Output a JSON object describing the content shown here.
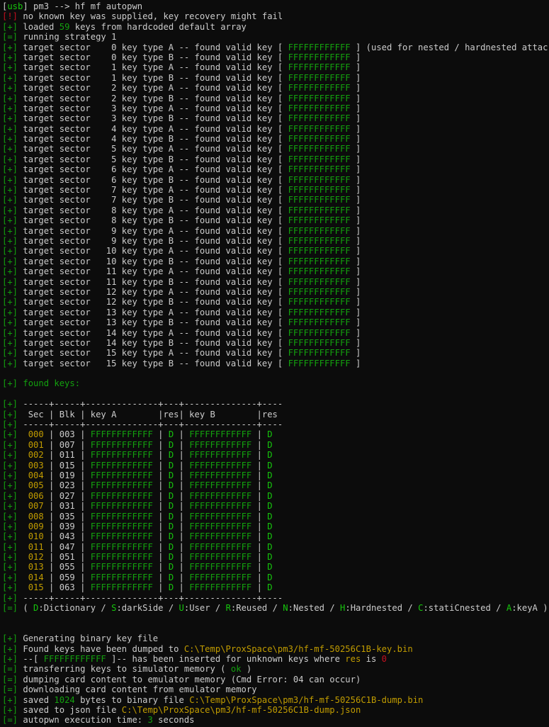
{
  "window": {
    "prompt_prefix": "usb",
    "prompt_host": "pm3",
    "command": "hf mf autopwn"
  },
  "colors": {
    "background": "#0c0c0c",
    "text": "#cccccc",
    "green": "#13a10e",
    "bright_green": "#16c60c",
    "yellow": "#c19c00",
    "red": "#c50f1f"
  },
  "intro": [
    {
      "tag": "!",
      "text": "no known key was supplied, key recovery might fail"
    },
    {
      "tag": "+",
      "pre": "loaded ",
      "num": "59",
      "post": " keys from hardcoded default array"
    },
    {
      "tag": "=",
      "text": "running strategy 1"
    }
  ],
  "sector_key": "FFFFFFFFFFFF",
  "first_note": "(used for nested / hardnested attack)",
  "sector_lines": [
    {
      "sec": "0",
      "type": "A"
    },
    {
      "sec": "0",
      "type": "B"
    },
    {
      "sec": "1",
      "type": "A"
    },
    {
      "sec": "1",
      "type": "B"
    },
    {
      "sec": "2",
      "type": "A"
    },
    {
      "sec": "2",
      "type": "B"
    },
    {
      "sec": "3",
      "type": "A"
    },
    {
      "sec": "3",
      "type": "B"
    },
    {
      "sec": "4",
      "type": "A"
    },
    {
      "sec": "4",
      "type": "B"
    },
    {
      "sec": "5",
      "type": "A"
    },
    {
      "sec": "5",
      "type": "B"
    },
    {
      "sec": "6",
      "type": "A"
    },
    {
      "sec": "6",
      "type": "B"
    },
    {
      "sec": "7",
      "type": "A"
    },
    {
      "sec": "7",
      "type": "B"
    },
    {
      "sec": "8",
      "type": "A"
    },
    {
      "sec": "8",
      "type": "B"
    },
    {
      "sec": "9",
      "type": "A"
    },
    {
      "sec": "9",
      "type": "B"
    },
    {
      "sec": "10",
      "type": "A"
    },
    {
      "sec": "10",
      "type": "B"
    },
    {
      "sec": "11",
      "type": "A"
    },
    {
      "sec": "11",
      "type": "B"
    },
    {
      "sec": "12",
      "type": "A"
    },
    {
      "sec": "12",
      "type": "B"
    },
    {
      "sec": "13",
      "type": "A"
    },
    {
      "sec": "13",
      "type": "B"
    },
    {
      "sec": "14",
      "type": "A"
    },
    {
      "sec": "14",
      "type": "B"
    },
    {
      "sec": "15",
      "type": "A"
    },
    {
      "sec": "15",
      "type": "B"
    }
  ],
  "found_keys_label": "found keys:",
  "table": {
    "separator": "-----+-----+--------------+---+--------------+----",
    "headers": [
      "Sec",
      "Blk",
      "key A",
      "res",
      "key B",
      "res"
    ],
    "rows": [
      {
        "sec": "000",
        "blk": "003",
        "keyA": "FFFFFFFFFFFF",
        "resA": "D",
        "keyB": "FFFFFFFFFFFF",
        "resB": "D"
      },
      {
        "sec": "001",
        "blk": "007",
        "keyA": "FFFFFFFFFFFF",
        "resA": "D",
        "keyB": "FFFFFFFFFFFF",
        "resB": "D"
      },
      {
        "sec": "002",
        "blk": "011",
        "keyA": "FFFFFFFFFFFF",
        "resA": "D",
        "keyB": "FFFFFFFFFFFF",
        "resB": "D"
      },
      {
        "sec": "003",
        "blk": "015",
        "keyA": "FFFFFFFFFFFF",
        "resA": "D",
        "keyB": "FFFFFFFFFFFF",
        "resB": "D"
      },
      {
        "sec": "004",
        "blk": "019",
        "keyA": "FFFFFFFFFFFF",
        "resA": "D",
        "keyB": "FFFFFFFFFFFF",
        "resB": "D"
      },
      {
        "sec": "005",
        "blk": "023",
        "keyA": "FFFFFFFFFFFF",
        "resA": "D",
        "keyB": "FFFFFFFFFFFF",
        "resB": "D"
      },
      {
        "sec": "006",
        "blk": "027",
        "keyA": "FFFFFFFFFFFF",
        "resA": "D",
        "keyB": "FFFFFFFFFFFF",
        "resB": "D"
      },
      {
        "sec": "007",
        "blk": "031",
        "keyA": "FFFFFFFFFFFF",
        "resA": "D",
        "keyB": "FFFFFFFFFFFF",
        "resB": "D"
      },
      {
        "sec": "008",
        "blk": "035",
        "keyA": "FFFFFFFFFFFF",
        "resA": "D",
        "keyB": "FFFFFFFFFFFF",
        "resB": "D"
      },
      {
        "sec": "009",
        "blk": "039",
        "keyA": "FFFFFFFFFFFF",
        "resA": "D",
        "keyB": "FFFFFFFFFFFF",
        "resB": "D"
      },
      {
        "sec": "010",
        "blk": "043",
        "keyA": "FFFFFFFFFFFF",
        "resA": "D",
        "keyB": "FFFFFFFFFFFF",
        "resB": "D"
      },
      {
        "sec": "011",
        "blk": "047",
        "keyA": "FFFFFFFFFFFF",
        "resA": "D",
        "keyB": "FFFFFFFFFFFF",
        "resB": "D"
      },
      {
        "sec": "012",
        "blk": "051",
        "keyA": "FFFFFFFFFFFF",
        "resA": "D",
        "keyB": "FFFFFFFFFFFF",
        "resB": "D"
      },
      {
        "sec": "013",
        "blk": "055",
        "keyA": "FFFFFFFFFFFF",
        "resA": "D",
        "keyB": "FFFFFFFFFFFF",
        "resB": "D"
      },
      {
        "sec": "014",
        "blk": "059",
        "keyA": "FFFFFFFFFFFF",
        "resA": "D",
        "keyB": "FFFFFFFFFFFF",
        "resB": "D"
      },
      {
        "sec": "015",
        "blk": "063",
        "keyA": "FFFFFFFFFFFF",
        "resA": "D",
        "keyB": "FFFFFFFFFFFF",
        "resB": "D"
      }
    ]
  },
  "legend": [
    {
      "key": "D",
      "label": "Dictionary"
    },
    {
      "key": "S",
      "label": "darkSide"
    },
    {
      "key": "U",
      "label": "User"
    },
    {
      "key": "R",
      "label": "Reused"
    },
    {
      "key": "N",
      "label": "Nested"
    },
    {
      "key": "H",
      "label": "Hardnested"
    },
    {
      "key": "C",
      "label": "statiCnested"
    },
    {
      "key": "A",
      "label": "keyA"
    }
  ],
  "summary": {
    "generating": "Generating binary key file",
    "dumped_pre": "Found keys have been dumped to ",
    "key_file": "C:\\Temp\\ProxSpace\\pm3/hf-mf-50256C1B-key.bin",
    "inserted_key": "FFFFFFFFFFFF",
    "inserted_mid": "]-- has been inserted for unknown keys where ",
    "inserted_res": "res",
    "inserted_is": " is ",
    "inserted_zero": "0",
    "transfer_pre": "transferring keys to simulator memory ( ",
    "transfer_ok": "ok",
    "transfer_post": " )",
    "dumping": "dumping card content to emulator memory (Cmd Error: 04 can occur)",
    "downloading": "downloading card content from emulator memory",
    "saved_pre": "saved ",
    "saved_bytes": "1024",
    "saved_mid": " bytes to binary file ",
    "dump_bin": "C:\\Temp\\ProxSpace\\pm3/hf-mf-50256C1B-dump.bin",
    "json_pre": "saved to json file ",
    "dump_json": "C:\\Temp\\ProxSpace\\pm3/hf-mf-50256C1B-dump.json",
    "time_pre": "autopwn execution time: ",
    "time_val": "3",
    "time_post": " seconds"
  }
}
